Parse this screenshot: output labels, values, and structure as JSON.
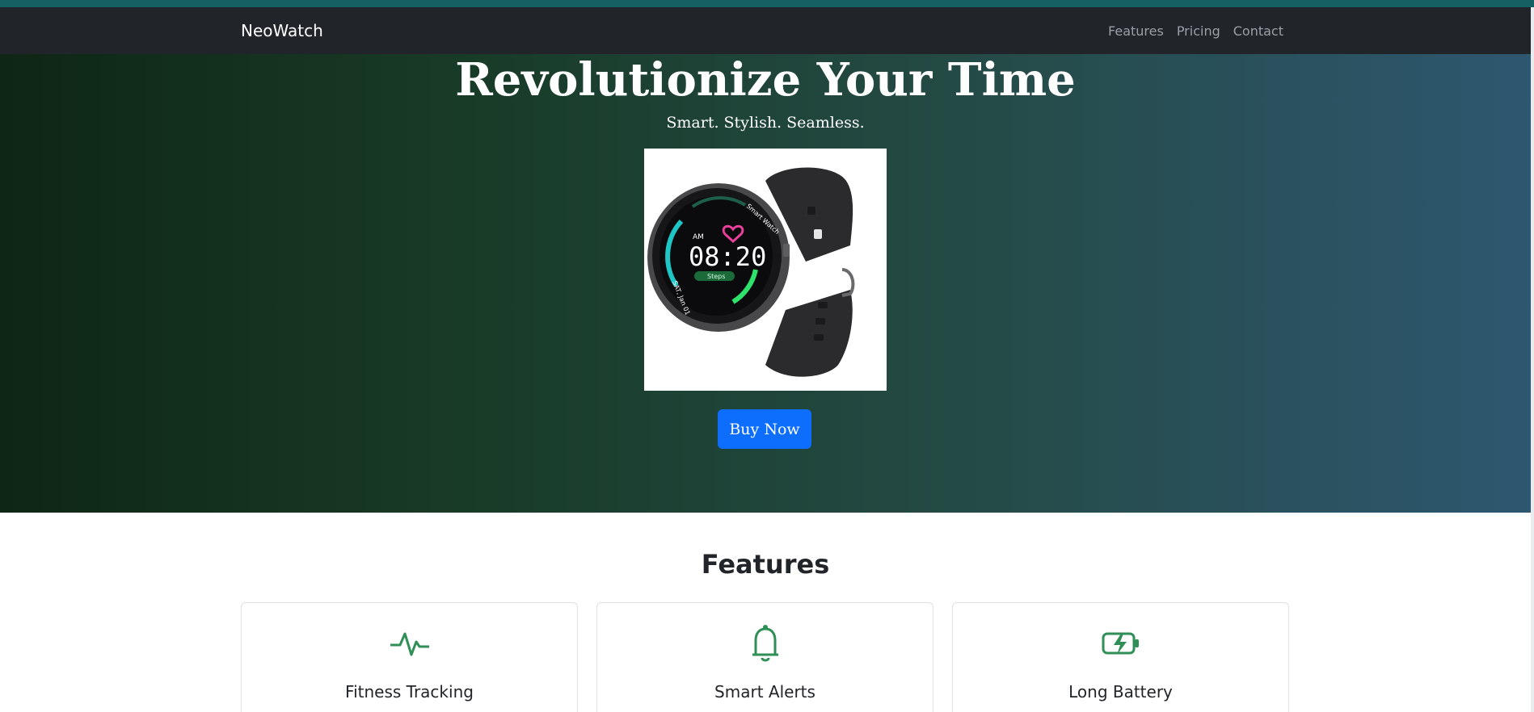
{
  "navbar": {
    "brand": "NeoWatch",
    "links": [
      "Features",
      "Pricing",
      "Contact"
    ]
  },
  "hero": {
    "title": "Revolutionize Your Time",
    "subtitle": "Smart. Stylish. Seamless.",
    "image_icon": "smartwatch-image",
    "watch_face": {
      "meridiem": "AM",
      "time": "08:20",
      "steps_label": "Steps",
      "date": "SAT, Jan 01",
      "bezel_text": "Smart Watch"
    },
    "buy_label": "Buy Now"
  },
  "features": {
    "title": "Features",
    "cards": [
      {
        "icon": "heartbeat-icon",
        "title": "Fitness Tracking"
      },
      {
        "icon": "bell-icon",
        "title": "Smart Alerts"
      },
      {
        "icon": "battery-charging-icon",
        "title": "Long Battery"
      }
    ]
  },
  "colors": {
    "accent": "#0d6efd",
    "icon_green": "#2f8f57",
    "navbar": "#212529",
    "top_strip": "#165f62",
    "hero_gradient_start": "#0e2615",
    "hero_gradient_end": "#2e5770"
  }
}
